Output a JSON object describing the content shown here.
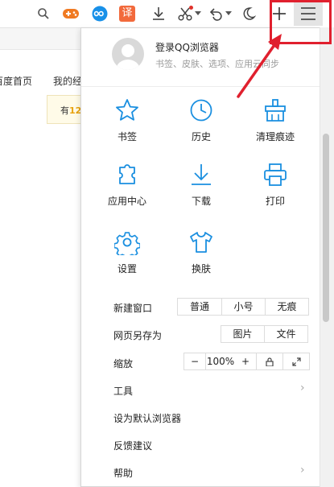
{
  "toolbar": {
    "icons": [
      "search-icon",
      "game-icon",
      "loop-icon",
      "translate-icon",
      "download-icon",
      "screenshot-icon",
      "undo-icon",
      "night-mode-icon",
      "plus-icon",
      "menu-icon"
    ],
    "translate_glyph": "译",
    "colors": {
      "game": "#f07a22",
      "loop": "#1890e8",
      "translate": "#f26a3c",
      "annotation": "#e0202e"
    }
  },
  "page": {
    "links": [
      "百度首页",
      "我的经"
    ],
    "tip_prefix": "有",
    "tip_value": "12"
  },
  "menu": {
    "login": {
      "title": "登录QQ浏览器",
      "subtitle": "书签、皮肤、选项、应用云同步"
    },
    "grid": [
      {
        "label": "书签",
        "icon": "star-icon"
      },
      {
        "label": "历史",
        "icon": "clock-icon"
      },
      {
        "label": "清理痕迹",
        "icon": "broom-icon"
      },
      {
        "label": "应用中心",
        "icon": "puzzle-icon"
      },
      {
        "label": "下载",
        "icon": "download-icon"
      },
      {
        "label": "打印",
        "icon": "printer-icon"
      },
      {
        "label": "设置",
        "icon": "gear-icon"
      },
      {
        "label": "换肤",
        "icon": "shirt-icon"
      }
    ],
    "new_window": {
      "label": "新建窗口",
      "options": [
        "普通",
        "小号",
        "无痕"
      ]
    },
    "save_as": {
      "label": "网页另存为",
      "options": [
        "图片",
        "文件"
      ]
    },
    "zoom": {
      "label": "缩放",
      "minus": "−",
      "value": "100%",
      "plus": "+"
    },
    "items": [
      {
        "label": "工具",
        "has_arrow": true
      },
      {
        "label": "设为默认浏览器",
        "has_arrow": false
      },
      {
        "label": "反馈建议",
        "has_arrow": false
      },
      {
        "label": "帮助",
        "has_arrow": true
      }
    ],
    "arrow": "›",
    "accent": "#1a8fe0"
  }
}
